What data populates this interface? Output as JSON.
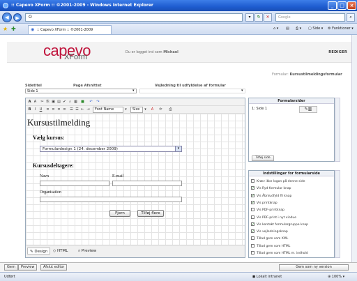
{
  "window": {
    "title": ":: Capevo XForm :: ©2001-2009 - Windows Internet Explorer"
  },
  "browser": {
    "address": "O",
    "search_placeholder": "Google",
    "tab_title": ":: Capevo XForm :: ©2001-2009",
    "tools": {
      "side": "Side",
      "funktioner": "Funktioner"
    }
  },
  "header": {
    "logo_main": "capevo",
    "logo_sub": "XForm",
    "logged_in_prefix": "Du er logget ind som",
    "logged_in_user": "Michael",
    "action": "REDIGER"
  },
  "breadcrumb": {
    "label": "Formular:",
    "value": "Kursustilmeldingsformular"
  },
  "form_meta": {
    "sidetitel_label": "Sidetitel",
    "sidetitel_value": "Side 1",
    "afsnit_label": "Page Afsnittet",
    "vejledning_label": "Vejledning til udfyldelse af formular"
  },
  "editor": {
    "title": "Kursustilmelding",
    "course_label": "Vælg kursus:",
    "course_value": "Formulardesign 1 (24. december 2009)",
    "participants_label": "Kursusdeltagere:",
    "name_label": "Navn",
    "email_label": "E-mail",
    "org_label": "Organisation",
    "remove_btn": "Fjern",
    "add_more_btn": "Tilføj flere",
    "font_select": "Font Name",
    "size_select": "Size",
    "tabs": {
      "design": "Design",
      "html": "HTML",
      "preview": "Preview"
    }
  },
  "formsider": {
    "title": "Formularsider",
    "page_item": "1: Side 1",
    "add_btn": "Tilføj side"
  },
  "settings": {
    "title": "Indstillinger for formularside",
    "options": [
      {
        "label": "Kræv ikke logon på denne side",
        "checked": false
      },
      {
        "label": "Vis Ryd formular knap",
        "checked": true
      },
      {
        "label": "Vis Åbn/udfyld fil knap",
        "checked": true
      },
      {
        "label": "Vis printknap",
        "checked": true
      },
      {
        "label": "Vis PDF-printknap",
        "checked": false
      },
      {
        "label": "Vis PDF-print i nyt vindue",
        "checked": false
      },
      {
        "label": "Vis kontakt formulargruppe knap",
        "checked": true
      },
      {
        "label": "Vis vejledningsknap",
        "checked": true
      },
      {
        "label": "Tillad gem som XML",
        "checked": false
      },
      {
        "label": "Tillad gem som HTML",
        "checked": false
      },
      {
        "label": "Tillad gem som HTML m. indhold",
        "checked": false
      }
    ]
  },
  "bottombar": {
    "gem": "Gem",
    "preview": "Preview",
    "afslut": "Afslut editor",
    "gem_ny": "Gem som ny version"
  },
  "statusbar": {
    "left": "Udført",
    "zone": "Lokalt intranet",
    "zoom": "100%"
  }
}
